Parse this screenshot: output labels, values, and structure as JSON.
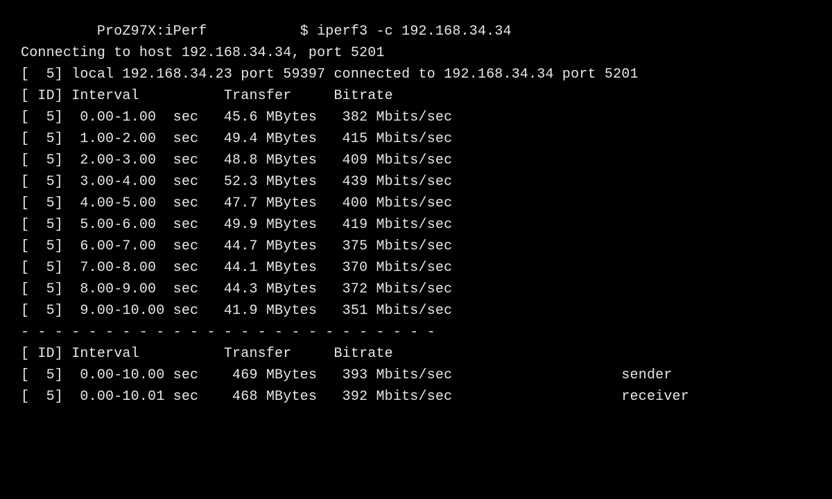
{
  "prompt": {
    "pad_before_host": "         ",
    "host": "ProZ97X:iPerf",
    "pad_between": "           ",
    "symbol": "$",
    "command": "iperf3 -c 192.168.34.34"
  },
  "connecting": "Connecting to host 192.168.34.34, port 5201",
  "local": "[  5] local 192.168.34.23 port 59397 connected to 192.168.34.34 port 5201",
  "header": {
    "id": "[ ID]",
    "interval": "Interval",
    "transfer": "Transfer",
    "bitrate": "Bitrate"
  },
  "rows": [
    {
      "id": "[  5]",
      "interval": "0.00-1.00",
      "unit": "sec",
      "transfer": "45.6 MBytes",
      "bitrate": "382 Mbits/sec"
    },
    {
      "id": "[  5]",
      "interval": "1.00-2.00",
      "unit": "sec",
      "transfer": "49.4 MBytes",
      "bitrate": "415 Mbits/sec"
    },
    {
      "id": "[  5]",
      "interval": "2.00-3.00",
      "unit": "sec",
      "transfer": "48.8 MBytes",
      "bitrate": "409 Mbits/sec"
    },
    {
      "id": "[  5]",
      "interval": "3.00-4.00",
      "unit": "sec",
      "transfer": "52.3 MBytes",
      "bitrate": "439 Mbits/sec"
    },
    {
      "id": "[  5]",
      "interval": "4.00-5.00",
      "unit": "sec",
      "transfer": "47.7 MBytes",
      "bitrate": "400 Mbits/sec"
    },
    {
      "id": "[  5]",
      "interval": "5.00-6.00",
      "unit": "sec",
      "transfer": "49.9 MBytes",
      "bitrate": "419 Mbits/sec"
    },
    {
      "id": "[  5]",
      "interval": "6.00-7.00",
      "unit": "sec",
      "transfer": "44.7 MBytes",
      "bitrate": "375 Mbits/sec"
    },
    {
      "id": "[  5]",
      "interval": "7.00-8.00",
      "unit": "sec",
      "transfer": "44.1 MBytes",
      "bitrate": "370 Mbits/sec"
    },
    {
      "id": "[  5]",
      "interval": "8.00-9.00",
      "unit": "sec",
      "transfer": "44.3 MBytes",
      "bitrate": "372 Mbits/sec"
    },
    {
      "id": "[  5]",
      "interval": "9.00-10.00",
      "unit": "sec",
      "transfer": "41.9 MBytes",
      "bitrate": "351 Mbits/sec"
    }
  ],
  "separator": "- - - - - - - - - - - - - - - - - - - - - - - - -",
  "summary": [
    {
      "id": "[  5]",
      "interval": "0.00-10.00",
      "unit": "sec",
      "transfer": " 469 MBytes",
      "bitrate": "393 Mbits/sec",
      "role": "sender"
    },
    {
      "id": "[  5]",
      "interval": "0.00-10.01",
      "unit": "sec",
      "transfer": " 468 MBytes",
      "bitrate": "392 Mbits/sec",
      "role": "receiver"
    }
  ]
}
